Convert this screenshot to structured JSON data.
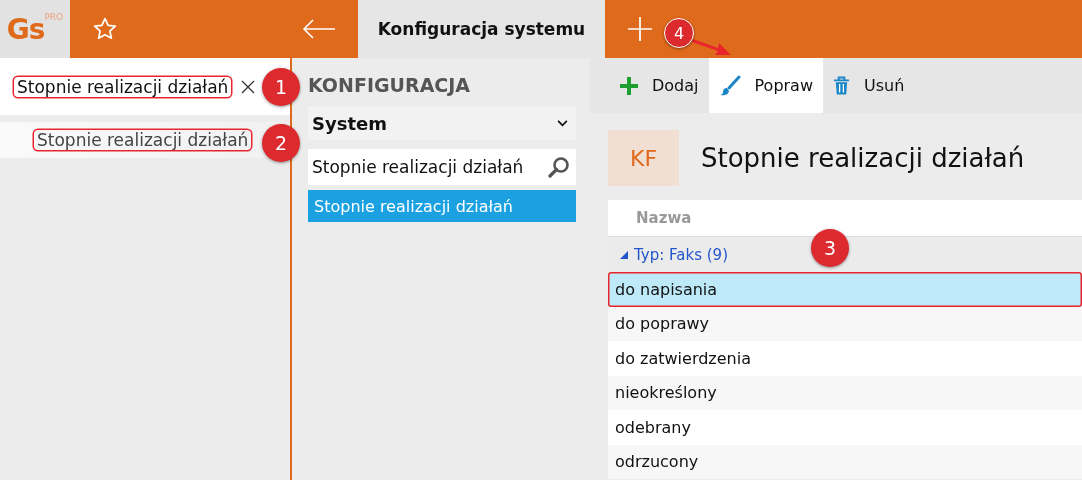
{
  "topbar": {
    "logo": "Gs",
    "logo_badge": "PRO",
    "tab_title": "Konfiguracja systemu"
  },
  "open_tabs": [
    {
      "label": "Stopnie realizacji działań",
      "selected": true,
      "closable": true
    },
    {
      "label": "Stopnie realizacji działań",
      "selected": false,
      "closable": false
    }
  ],
  "config": {
    "heading": "KONFIGURACJA",
    "dropdown": "System",
    "search": {
      "value": "Stopnie realizacji działań"
    },
    "items": [
      {
        "label": "Stopnie realizacji działań",
        "selected": true
      }
    ]
  },
  "toolbar": [
    {
      "kind": "add",
      "label": "Dodaj",
      "selected": false
    },
    {
      "kind": "edit",
      "label": "Popraw",
      "selected": true
    },
    {
      "kind": "delete",
      "label": "Usuń",
      "selected": false
    }
  ],
  "page": {
    "badge": "KF",
    "title": "Stopnie realizacji działań"
  },
  "table": {
    "columns": [
      "Nazwa"
    ],
    "group": {
      "label": "Typ: Faks (9)",
      "expanded": true
    },
    "rows": [
      {
        "name": "do napisania",
        "selected": true
      },
      {
        "name": "do poprawy",
        "selected": false
      },
      {
        "name": "do zatwierdzenia",
        "selected": false
      },
      {
        "name": "nieokreślony",
        "selected": false
      },
      {
        "name": "odebrany",
        "selected": false
      },
      {
        "name": "odrzucony",
        "selected": false
      }
    ]
  },
  "callouts": [
    "1",
    "2",
    "3",
    "4"
  ]
}
